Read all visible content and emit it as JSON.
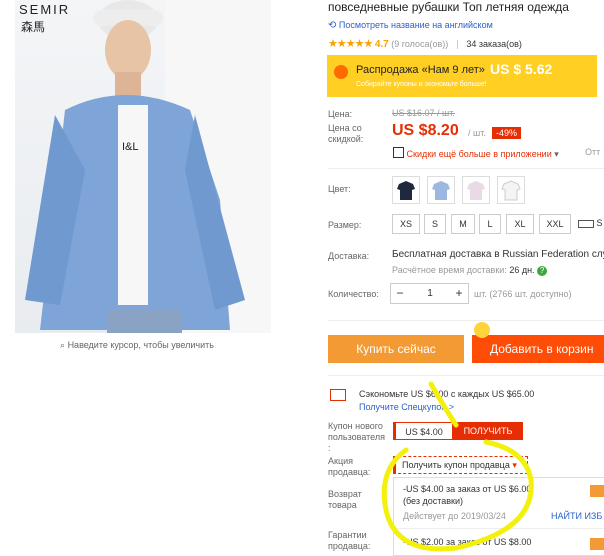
{
  "image": {
    "brand": "SEMIR",
    "brand_cn": "森馬",
    "zoom_hint": "Наведите курсор, чтобы увеличить"
  },
  "title": "повседневные рубашки Топ летняя одежда",
  "translate_link": "Посмотреть название на английском",
  "rating": {
    "score": "4.7",
    "votes": "(9 голоса(ов))",
    "orders": "34 заказа(ов)"
  },
  "promo": {
    "text": "Распродажа «Нам 9 лет»",
    "price": "US $ 5.62",
    "sub": "Собирайте купоны и экономьте больше!"
  },
  "price": {
    "label": "Цена:",
    "old": "US $16.07 / шт.",
    "discount_label": "Цена со скидкой:",
    "new": "US $8.20",
    "unit": "/ шт.",
    "off": "-49%"
  },
  "app_discount": {
    "text": "Скидки ещё больше в приложении",
    "more": "Отт"
  },
  "color": {
    "label": "Цвет:",
    "swatch_colors": [
      "#20283e",
      "#9db8e0",
      "#e9dbe6",
      "#f4f4f4"
    ]
  },
  "size": {
    "label": "Размер:",
    "options": [
      "XS",
      "S",
      "M",
      "L",
      "XL",
      "XXL"
    ],
    "more": "S"
  },
  "delivery": {
    "label": "Доставка:",
    "text": "Бесплатная доставка в Russian Federation слу",
    "time_label": "Расчётное время доставки:",
    "time_value": "26 дн."
  },
  "quantity": {
    "label": "Количество:",
    "value": "1",
    "minus": "−",
    "plus": "+",
    "stock": "шт. (2766 шт. доступно)"
  },
  "buttons": {
    "buy": "Купить сейчас",
    "cart": "Добавить в корзин"
  },
  "coupon_promo": {
    "text": "Сэкономьте US $6.00 с каждых US $65.00",
    "link": "Получите Спецкупон >"
  },
  "new_user": {
    "label": "Купон нового пользователя :",
    "amount": "US $4.00",
    "get": "ПОЛУЧИТЬ"
  },
  "seller": {
    "label": "Акция продавца:",
    "dropdown": "Получить купон продавца"
  },
  "return_label": "Возврат товара",
  "guarantee_label": "Гарантии продавца:",
  "coupons": [
    {
      "text": "-US $4.00 за заказ от US $6.00 (без доставки)",
      "valid": "Действует до 2019/03/24",
      "find": "НАЙТИ ИЗБ"
    },
    {
      "text": "-US $2.00 за заказ от US $8.00"
    }
  ]
}
